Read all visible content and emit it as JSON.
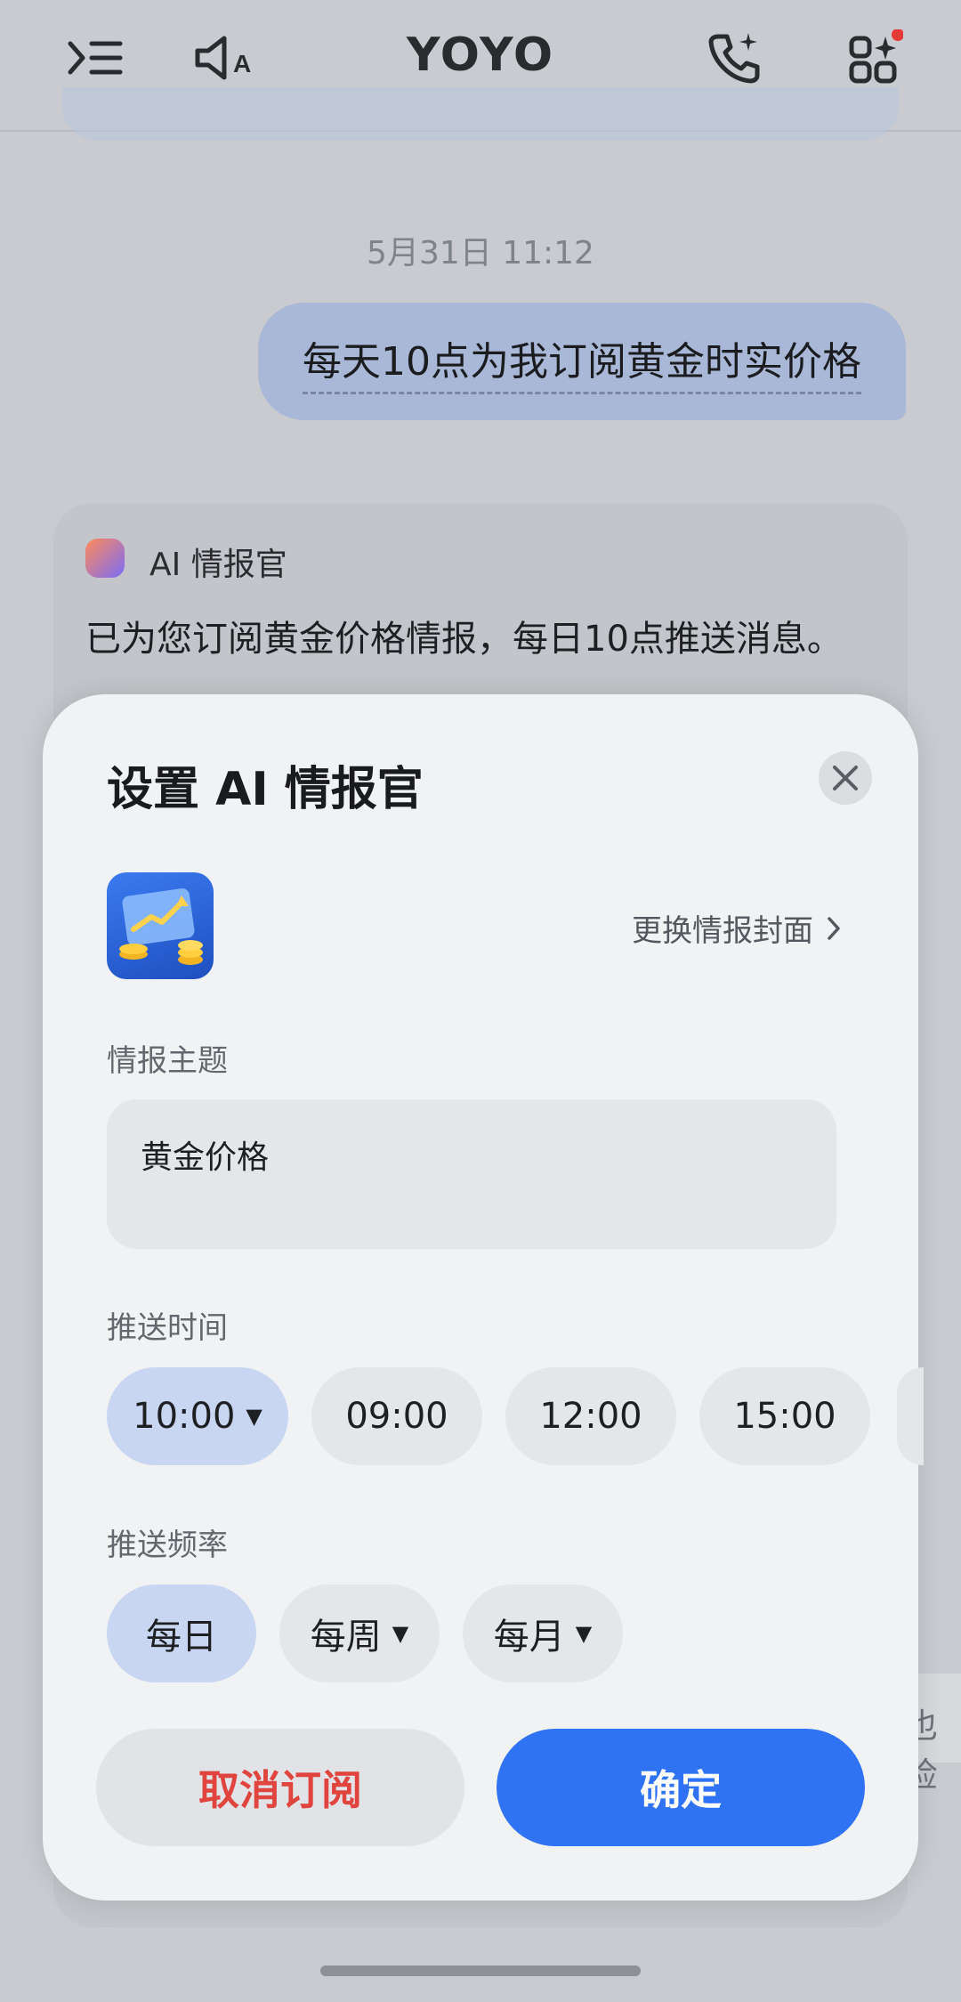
{
  "header": {
    "title": "YOYO",
    "icons": [
      "menu-collapse-icon",
      "voice-broadcast-icon",
      "ai-phone-call-icon",
      "apps-grid-icon"
    ],
    "notification_dot_color": "#e53935"
  },
  "chat": {
    "timestamp": "5月31日 11:12",
    "user_message": "每天10点为我订阅黄金时实价格",
    "ai_card": {
      "name": "AI 情报官",
      "message": "已为您订阅黄金价格情报，每日10点推送消息。"
    },
    "side_peek_text": "也检"
  },
  "sheet": {
    "title": "设置 AI 情报官",
    "change_cover_label": "更换情报封面",
    "topic_label": "情报主题",
    "topic_value": "黄金价格",
    "time_label": "推送时间",
    "time_options": [
      {
        "label": "10:00",
        "selected": true,
        "dropdown": true
      },
      {
        "label": "09:00",
        "selected": false
      },
      {
        "label": "12:00",
        "selected": false
      },
      {
        "label": "15:00",
        "selected": false
      }
    ],
    "frequency_label": "推送频率",
    "frequency_options": [
      {
        "label": "每日",
        "selected": true
      },
      {
        "label": "每周",
        "selected": false,
        "dropdown": true
      },
      {
        "label": "每月",
        "selected": false,
        "dropdown": true
      }
    ],
    "cancel_label": "取消订阅",
    "confirm_label": "确定"
  },
  "colors": {
    "accent": "#2f72f4",
    "danger": "#e0443e",
    "selected_pill": "#c8d6f2"
  }
}
